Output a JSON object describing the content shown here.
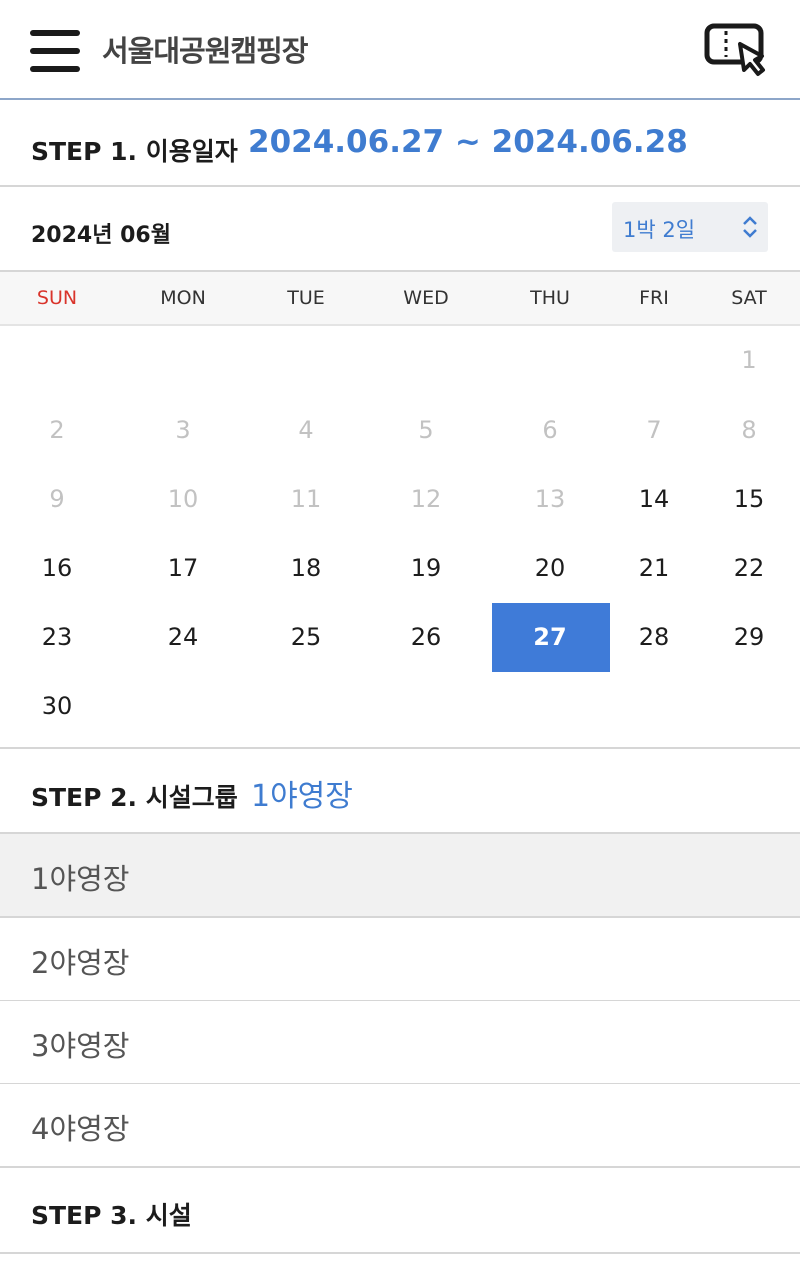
{
  "header": {
    "title": "서울대공원캠핑장"
  },
  "step1": {
    "label": "STEP 1. 이용일자",
    "value": "2024.06.27 ~ 2024.06.28"
  },
  "calendar": {
    "month_label": "2024년 06월",
    "nights_select": "1박 2일",
    "weekdays": [
      "SUN",
      "MON",
      "TUE",
      "WED",
      "THU",
      "FRI",
      "SAT"
    ],
    "days": [
      "1",
      "2",
      "3",
      "4",
      "5",
      "6",
      "7",
      "8",
      "9",
      "10",
      "11",
      "12",
      "13",
      "14",
      "15",
      "16",
      "17",
      "18",
      "19",
      "20",
      "21",
      "22",
      "23",
      "24",
      "25",
      "26",
      "27",
      "28",
      "29",
      "30"
    ],
    "selected_day": "27"
  },
  "step2": {
    "label": "STEP 2. 시설그룹",
    "value": "1야영장"
  },
  "groups": [
    "1야영장",
    "2야영장",
    "3야영장",
    "4야영장"
  ],
  "step3": {
    "label": "STEP 3. 시설"
  },
  "colors": {
    "accent": "#3f7bd8",
    "sunday": "#d9342b",
    "disabled": "#c2c2c2"
  }
}
